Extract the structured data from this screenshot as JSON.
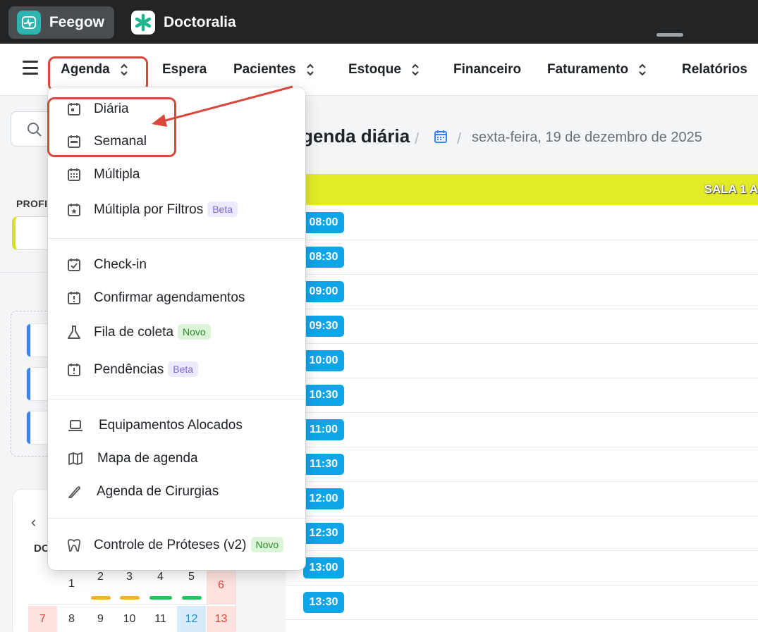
{
  "apps": {
    "feegow_label": "Feegow",
    "doctoralia_label": "Doctoralia"
  },
  "nav": {
    "items": [
      {
        "label": "Agenda",
        "chevron": true
      },
      {
        "label": "Espera",
        "chevron": false
      },
      {
        "label": "Pacientes",
        "chevron": true
      },
      {
        "label": "Estoque",
        "chevron": true
      },
      {
        "label": "Financeiro",
        "chevron": false
      },
      {
        "label": "Faturamento",
        "chevron": true
      },
      {
        "label": "Relatórios",
        "chevron": false
      }
    ]
  },
  "sidebar": {
    "prof_label": "PROFI"
  },
  "calendar": {
    "dow": "DO",
    "row1": [
      "1",
      "2",
      "3",
      "4",
      "5",
      "6"
    ],
    "row2": [
      "7",
      "8",
      "9",
      "10",
      "11",
      "12",
      "13"
    ]
  },
  "main": {
    "title": "genda diária",
    "separator": "/",
    "date": "sexta-feira, 19 de dezembro de 2025",
    "sala": "SALA 1 A",
    "times": [
      "08:00",
      "08:30",
      "09:00",
      "09:30",
      "10:00",
      "10:30",
      "11:00",
      "11:30",
      "12:00",
      "12:30",
      "13:00",
      "13:30"
    ]
  },
  "menu": {
    "diaria": "Diária",
    "semanal": "Semanal",
    "multipla": "Múltipla",
    "multipla_filtros": "Múltipla por Filtros",
    "beta": "Beta",
    "checkin": "Check-in",
    "confirmar": "Confirmar agendamentos",
    "fila": "Fila de coleta",
    "novo": "Novo",
    "pendencias": "Pendências",
    "equipamentos": "Equipamentos Alocados",
    "mapa": "Mapa de agenda",
    "cirurgias": "Agenda de Cirurgias",
    "proteses": "Controle de Próteses (v2)"
  },
  "colors": {
    "accent_red": "#d9483b",
    "time_badge": "#0ea5e9",
    "sala_bar": "#e3ea27"
  }
}
